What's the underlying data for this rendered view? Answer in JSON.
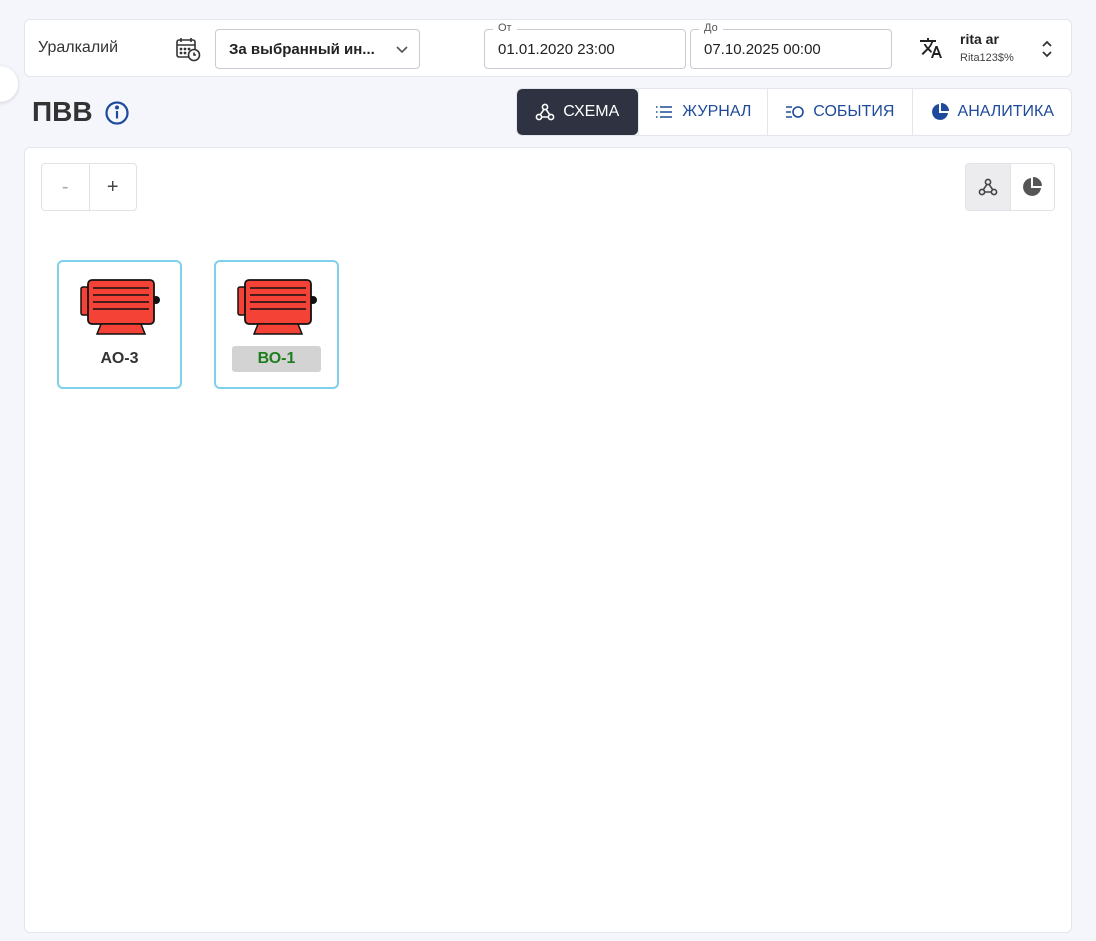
{
  "header": {
    "company": "Уралкалий",
    "period": "За выбранный ин...",
    "date_from_label": "От",
    "date_from": "01.01.2020 23:00",
    "date_to_label": "До",
    "date_to": "07.10.2025 00:00",
    "user_name": "rita ar",
    "user_login": "Rita123$%"
  },
  "page": {
    "title": "ПВВ"
  },
  "tabs": [
    {
      "label": "СХЕМА",
      "icon": "schema-icon",
      "active": true
    },
    {
      "label": "ЖУРНАЛ",
      "icon": "list-icon",
      "active": false
    },
    {
      "label": "СОБЫТИЯ",
      "icon": "events-icon",
      "active": false
    },
    {
      "label": "АНАЛИТИКА",
      "icon": "pie-chart-icon",
      "active": false
    }
  ],
  "zoom": {
    "minus": "-",
    "plus": "+"
  },
  "devices": [
    {
      "label": "АО-3",
      "icon": "fan-icon",
      "status_color": "#f44336"
    },
    {
      "label": "ВО-1",
      "icon": "fan-icon",
      "status_color": "#f44336",
      "label_color": "#1f7d1f",
      "badge_color": "#d3d3d3"
    }
  ],
  "colors": {
    "accent": "#1d4a9a",
    "active_tab": "#2f3341",
    "card_border": "#7fd0ea",
    "fan": "#f44336"
  }
}
